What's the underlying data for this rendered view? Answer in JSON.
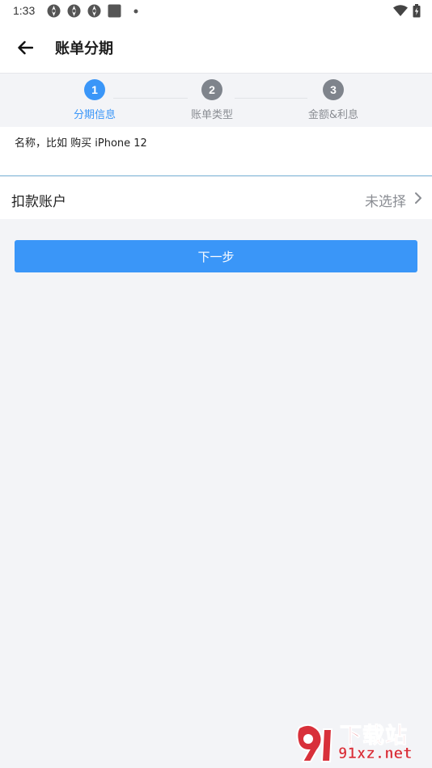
{
  "status_bar": {
    "time": "1:33",
    "left_icons": [
      "app-notification-icon",
      "app-notification-icon",
      "app-notification-icon",
      "square-notification-icon",
      "dot-icon"
    ],
    "right_icons": [
      "wifi-icon",
      "battery-charging-icon"
    ]
  },
  "app_bar": {
    "title": "账单分期",
    "back_icon": "arrow-left-icon"
  },
  "stepper": {
    "steps": [
      {
        "number": "1",
        "label": "分期信息",
        "active": true
      },
      {
        "number": "2",
        "label": "账单类型",
        "active": false
      },
      {
        "number": "3",
        "label": "金额&利息",
        "active": false
      }
    ]
  },
  "form": {
    "name_placeholder": "名称，比如 购买 iPhone 12",
    "name_value": "",
    "account_label": "扣款账户",
    "account_value": "未选择"
  },
  "actions": {
    "next_label": "下一步"
  },
  "watermark": {
    "cn_text": "下载站",
    "en_text": "91xz.net"
  },
  "colors": {
    "accent": "#3a96f8",
    "inactive_step": "#7f848c",
    "page_bg": "#f3f4f7",
    "watermark": "#d8303a"
  }
}
